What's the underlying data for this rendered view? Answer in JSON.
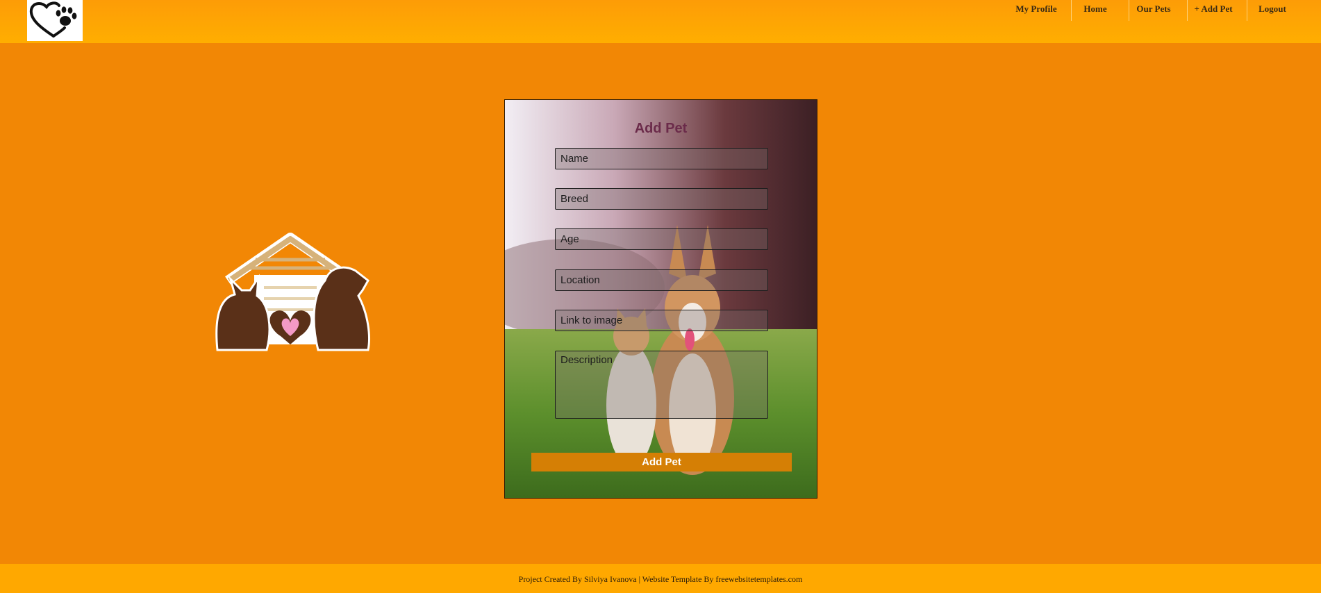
{
  "header": {
    "logo_icon": "heart-paw-icon",
    "nav": [
      {
        "label": "My Profile"
      },
      {
        "label": "Home"
      },
      {
        "label": "Our Pets"
      },
      {
        "label": "+ Add Pet"
      },
      {
        "label": "Logout"
      }
    ]
  },
  "illustration": {
    "icon": "pet-house-icon"
  },
  "form": {
    "title": "Add Pet",
    "fields": {
      "name": {
        "placeholder": "Name"
      },
      "breed": {
        "placeholder": "Breed"
      },
      "age": {
        "placeholder": "Age"
      },
      "location": {
        "placeholder": "Location"
      },
      "image": {
        "placeholder": "Link to image"
      },
      "description": {
        "placeholder": "Description"
      }
    },
    "submit_label": "Add Pet"
  },
  "footer": {
    "text": "Project Created By Silviya Ivanova | Website Template By freewebsitetemplates.com"
  },
  "colors": {
    "background": "#f28705",
    "header": "#ffae00",
    "button": "#d57f05",
    "title": "#6b2b4a"
  }
}
